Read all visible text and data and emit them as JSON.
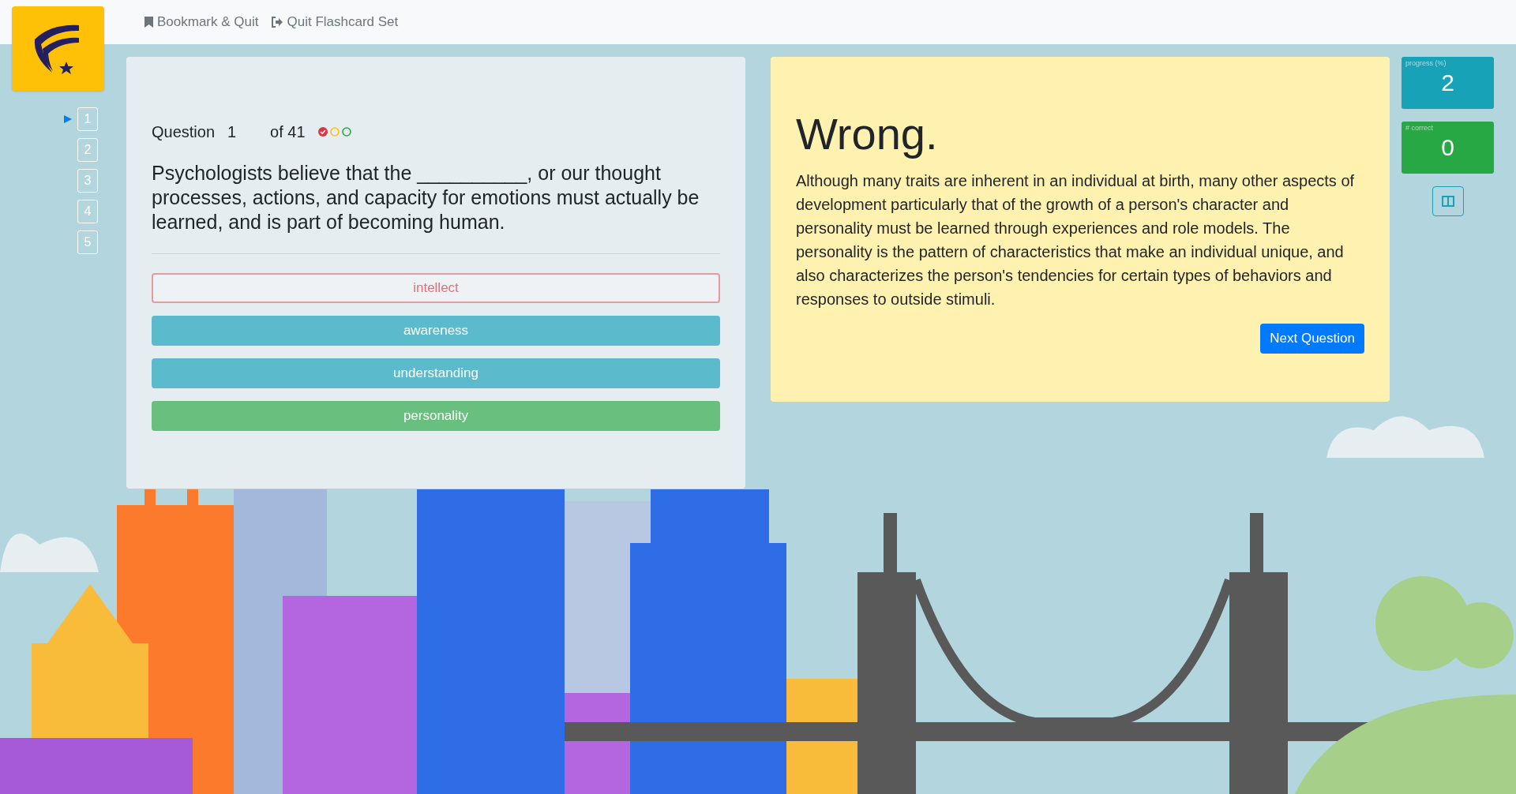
{
  "nav_links": [
    {
      "label": "Bookmark & Quit",
      "kind": "bookmark"
    },
    {
      "label": "Quit Flashcard Set",
      "kind": "quit"
    }
  ],
  "question_nav": [
    {
      "label": "1",
      "selected": true
    },
    {
      "label": "2",
      "selected": false
    },
    {
      "label": "3",
      "selected": false
    },
    {
      "label": "4",
      "selected": false
    },
    {
      "label": "5",
      "selected": false
    }
  ],
  "question": {
    "label": "Question",
    "number": "1",
    "total": "of 41",
    "attempt_markers": [
      {
        "color": "#dc3545",
        "checked": true
      },
      {
        "color": "#ffc107",
        "checked": false
      },
      {
        "color": "#28a745",
        "checked": false
      }
    ],
    "text": "Psychologists believe that the __________, or our thought processes, actions, and capacity for emotions must actually be learned, and is part of becoming human.",
    "answers": [
      {
        "label": "intellect",
        "kind": "wrong"
      },
      {
        "label": "awareness",
        "kind": "neutral"
      },
      {
        "label": "understanding",
        "kind": "neutral"
      },
      {
        "label": "personality",
        "kind": "correct"
      }
    ]
  },
  "feedback": {
    "title": "Wrong.",
    "text": "Although many traits are inherent in an individual at birth, many other aspects of development particularly that of the growth of a person's character and personality must be learned through experiences and role models. The personality is the pattern of characteristics that make an individual unique, and also characterizes the person's tendencies for certain types of behaviors and responses to outside stimuli.",
    "button": "Next Question"
  },
  "stats": [
    {
      "label": "progress (%)",
      "value": "2",
      "kind": "progress"
    },
    {
      "label": "# correct",
      "value": "0",
      "kind": "correct"
    }
  ]
}
